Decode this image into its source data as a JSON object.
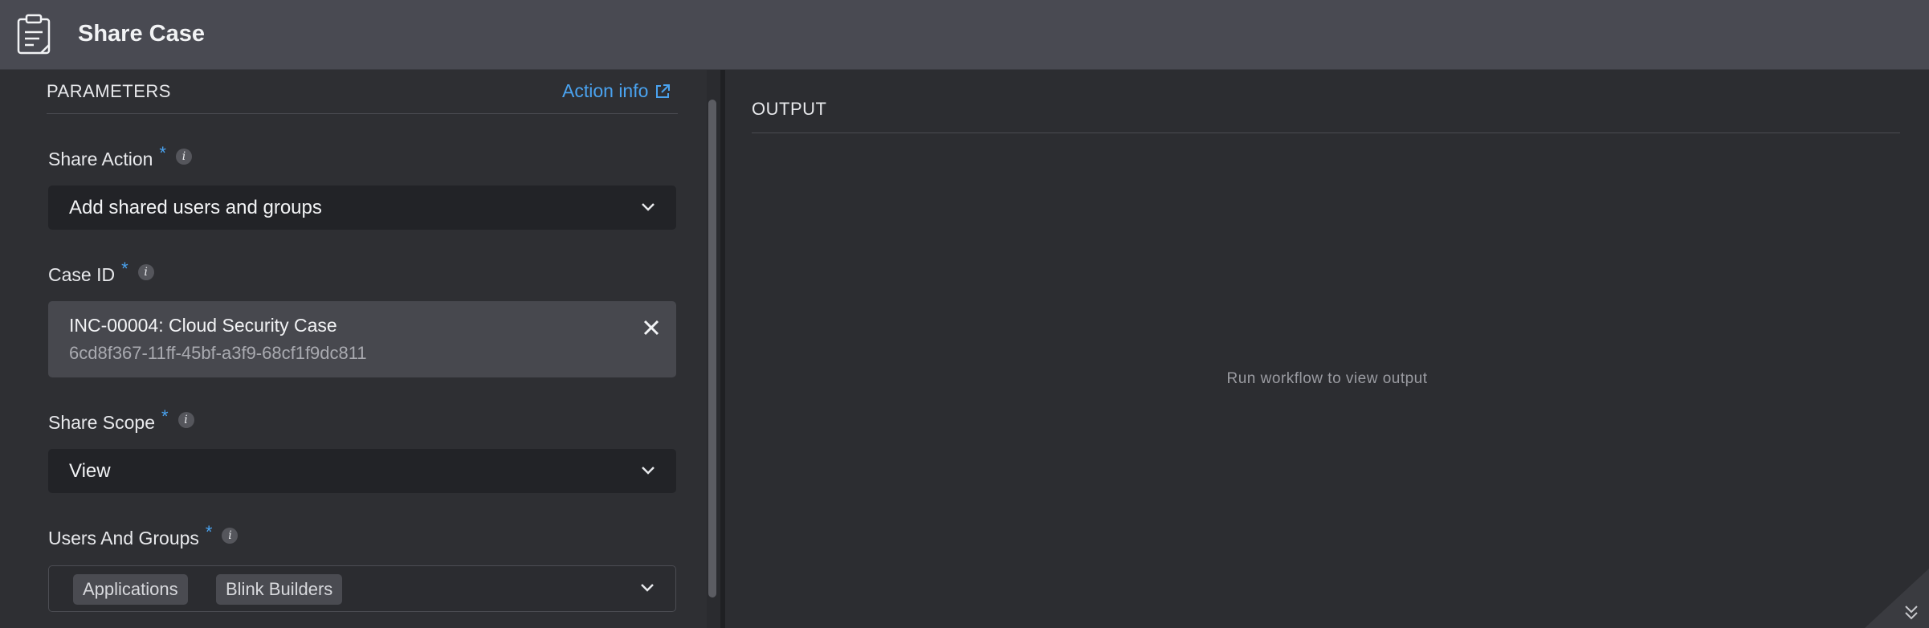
{
  "header": {
    "title": "Share Case",
    "icon": "clipboard-list-icon"
  },
  "parameters": {
    "title": "PARAMETERS",
    "action_info": "Action info",
    "share_action": {
      "label": "Share Action",
      "required": "*",
      "value": "Add shared users and groups"
    },
    "case_id": {
      "label": "Case ID",
      "required": "*",
      "name": "INC-00004: Cloud Security Case",
      "uuid": "6cd8f367-11ff-45bf-a3f9-68cf1f9dc811"
    },
    "share_scope": {
      "label": "Share Scope",
      "required": "*",
      "value": "View"
    },
    "users_and_groups": {
      "label": "Users And Groups",
      "required": "*",
      "chips": [
        "Applications",
        "Blink Builders"
      ]
    }
  },
  "output": {
    "title": "OUTPUT",
    "empty_message": "Run workflow to view output"
  },
  "colors": {
    "accent": "#4aa3f0",
    "header_bg": "#494a52",
    "panel_bg": "#2e2f33"
  }
}
